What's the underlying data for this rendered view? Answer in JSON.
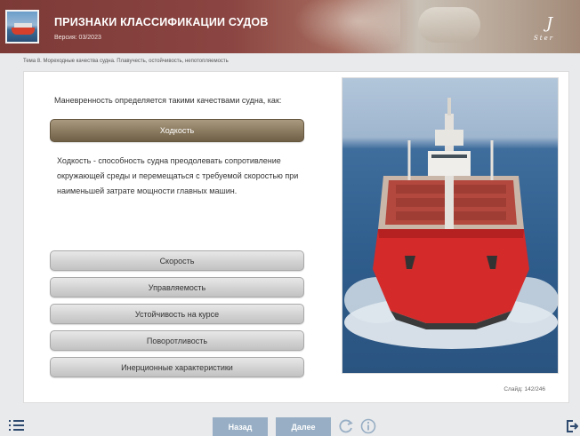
{
  "header": {
    "title": "ПРИЗНАКИ КЛАССИФИКАЦИИ СУДОВ",
    "version": "Версия: 03/2023",
    "logo_text": "Ster",
    "thumbnail": "ship-thumbnail"
  },
  "breadcrumb": "Тема 8. Мореходные качества судна. Плавучесть, остойчивость, непотопляемость",
  "question": "Маневренность определяется такими качествами судна, как:",
  "selected_answer": "Ходкость",
  "explanation": "Ходкость - способность судна преодолевать сопротивление окружающей среды и перемещаться с требуемой скоростью при наименьшей затрате мощности главных машин.",
  "options": [
    "Скорость",
    "Управляемость",
    "Устойчивость на курсе",
    "Поворотливость",
    "Инерционные характеристики"
  ],
  "image": "bulk-carrier-ship-photo",
  "slide_counter": "Слайд: 142/246",
  "footer": {
    "back_label": "Назад",
    "next_label": "Далее",
    "icons": [
      "menu-icon",
      "refresh-icon",
      "info-icon",
      "exit-icon"
    ]
  },
  "colors": {
    "selected_button": "#8c7c61",
    "nav_button": "#97aec4",
    "header_primary": "#7c3a37"
  }
}
